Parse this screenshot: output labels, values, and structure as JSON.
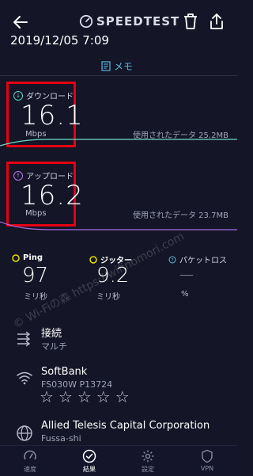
{
  "header": {
    "brand": "SPEEDTEST",
    "datetime": "2019/12/05 7:09",
    "memo_label": "メモ"
  },
  "download": {
    "label": "ダウンロード",
    "value": "16.1",
    "unit": "Mbps",
    "data_used": "使用されたデータ 25.2MB",
    "icon_color": "#5bd6c8"
  },
  "upload": {
    "label": "アップロード",
    "value": "16.2",
    "unit": "Mbps",
    "data_used": "使用されたデータ 23.7MB",
    "icon_color": "#b97cf0"
  },
  "stats": {
    "ping": {
      "label": "Ping",
      "value": "97",
      "unit": "ミリ秒"
    },
    "jitter": {
      "label": "ジッター",
      "value": "9.2",
      "unit": "ミリ秒"
    },
    "loss": {
      "label": "パケットロス",
      "value": "—",
      "unit": "%"
    }
  },
  "connection": {
    "title": "接続",
    "value": "マルチ"
  },
  "provider": {
    "name": "SoftBank",
    "device": "FS030W  P13724",
    "rating_stars": "☆☆☆☆☆"
  },
  "server": {
    "name": "Allied Telesis Capital Corporation",
    "location": "Fussa-shi"
  },
  "tabs": [
    {
      "label": "速度",
      "icon": "gauge-icon"
    },
    {
      "label": "結果",
      "icon": "check-circle-icon"
    },
    {
      "label": "設定",
      "icon": "gear-icon"
    },
    {
      "label": "VPN",
      "icon": "shield-icon"
    }
  ],
  "watermark": "© Wi-Fiの森 https://wifinomori.com",
  "colors": {
    "background": "#141526",
    "highlight_box": "#e60012",
    "download_line": "#6fd9c8",
    "upload_line": "#a56ee6",
    "accent": "#5bb8e0"
  }
}
